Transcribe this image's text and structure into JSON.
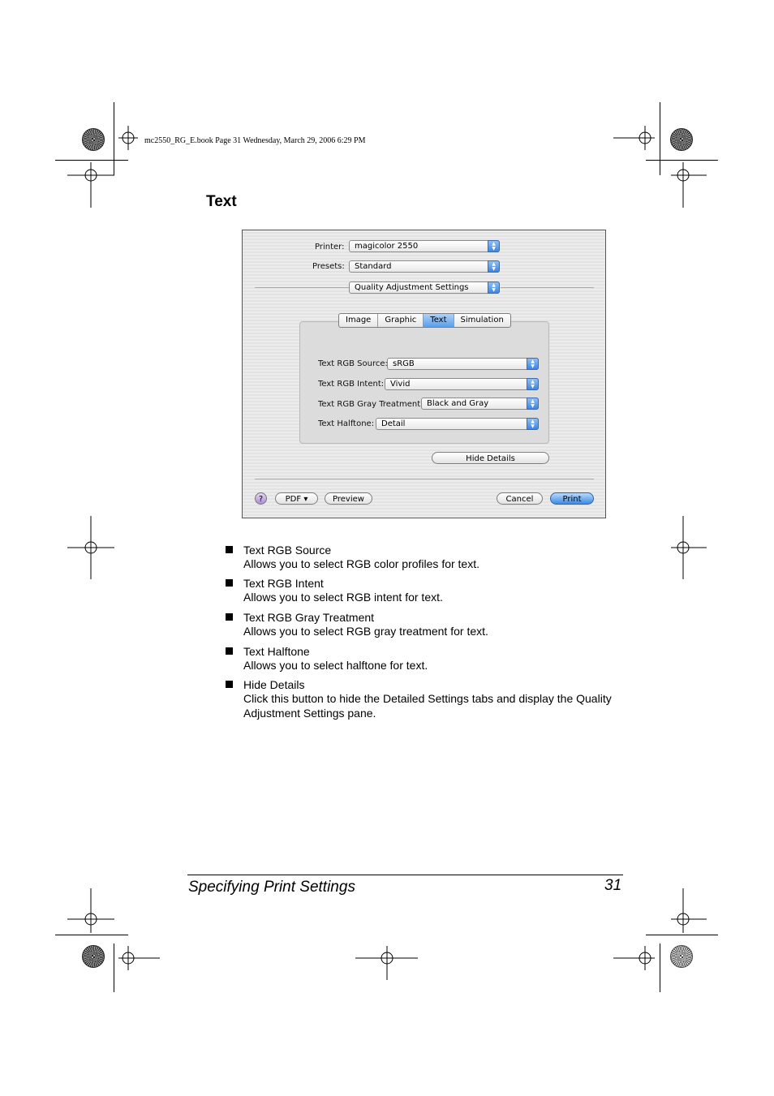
{
  "slug": "mc2550_RG_E.book  Page 31  Wednesday, March 29, 2006  6:29 PM",
  "heading": "Text",
  "dialog": {
    "printer_label": "Printer:",
    "printer_value": "magicolor 2550",
    "presets_label": "Presets:",
    "presets_value": "Standard",
    "pane_value": "Quality Adjustment Settings",
    "tabs": [
      "Image",
      "Graphic",
      "Text",
      "Simulation"
    ],
    "selected_tab": "Text",
    "fields": [
      {
        "label": "Text RGB Source:",
        "value": "sRGB"
      },
      {
        "label": "Text RGB Intent:",
        "value": "Vivid"
      },
      {
        "label": "Text RGB Gray Treatment:",
        "value": "Black and Gray"
      },
      {
        "label": "Text Halftone:",
        "value": "Detail"
      }
    ],
    "hide_details": "Hide Details",
    "help": "?",
    "pdf": "PDF ▾",
    "preview": "Preview",
    "cancel": "Cancel",
    "print": "Print"
  },
  "items": [
    {
      "title": "Text RGB Source",
      "desc": "Allows you to select RGB color profiles for text."
    },
    {
      "title": "Text RGB Intent",
      "desc": "Allows you to select RGB intent for text."
    },
    {
      "title": "Text RGB Gray Treatment",
      "desc": "Allows you to select RGB gray treatment for text."
    },
    {
      "title": "Text Halftone",
      "desc": "Allows you to select halftone for text."
    },
    {
      "title": "Hide Details",
      "desc": "Click this button to hide the Detailed Settings tabs and display the Quality Adjustment Settings pane."
    }
  ],
  "footer": {
    "title": "Specifying Print Settings",
    "page": "31"
  }
}
